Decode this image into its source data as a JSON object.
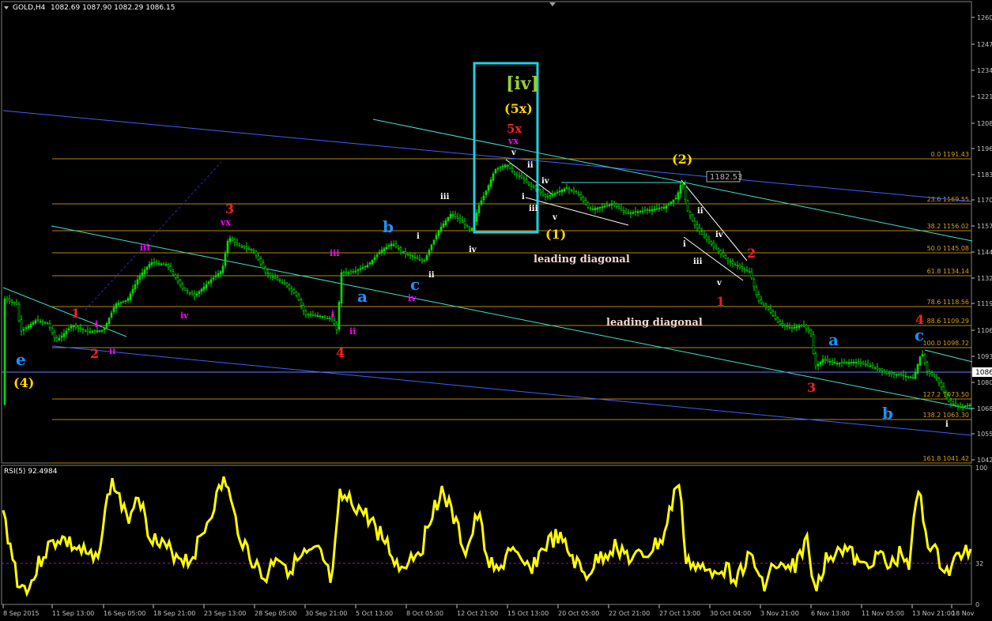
{
  "window": {
    "symbol_label": "GOLD,H4",
    "ohlc": "1082.69 1087.90 1082.29 1086.15",
    "rsi_label": "RSI(5) 92.4984"
  },
  "price_axis": {
    "labels": [
      "1260",
      "1247",
      "1234",
      "1221",
      "1208",
      "1196",
      "1183",
      "1170",
      "1157",
      "1144",
      "1132",
      "1119",
      "1106",
      "1093",
      "1080",
      "1068",
      "1055",
      "1042"
    ],
    "current_price": "1086",
    "range": [
      1037,
      1265
    ]
  },
  "rsi_axis": {
    "labels": [
      "100",
      "32",
      "0"
    ],
    "level": 32
  },
  "time_axis": {
    "labels": [
      "8 Sep 2015",
      "11 Sep 13:00",
      "16 Sep 05:00",
      "18 Sep 21:00",
      "23 Sep 13:00",
      "28 Sep 05:00",
      "30 Sep 21:00",
      "5 Oct 13:00",
      "8 Oct 05:00",
      "12 Oct 21:00",
      "15 Oct 13:00",
      "20 Oct 05:00",
      "22 Oct 21:00",
      "27 Oct 13:00",
      "30 Oct 04:00",
      "3 Nov 21:00",
      "6 Nov 13:00",
      "11 Nov 05:00",
      "13 Nov 21:00",
      "18 Nov"
    ]
  },
  "fib_levels": [
    {
      "label": "0.0  1191.43"
    },
    {
      "label": "23.6  1169.55"
    },
    {
      "label": "38.2  1156.02"
    },
    {
      "label": "50.0  1145.08"
    },
    {
      "label": "61.8  1134.14"
    },
    {
      "label": "78.6  1118.56"
    },
    {
      "label": "88.6  1109.29"
    },
    {
      "label": "100.0  1098.72"
    },
    {
      "label": "127.2  1073.50"
    },
    {
      "label": "138.2  1063.30"
    },
    {
      "label": "161.8  1041.42"
    }
  ],
  "price_tag": "1182.53",
  "annotations": [
    {
      "text": "[iv]"
    },
    {
      "text": "(5x)"
    },
    {
      "text": "5x"
    },
    {
      "text": "vx"
    },
    {
      "text": "v"
    },
    {
      "text": "ii"
    },
    {
      "text": "iv"
    },
    {
      "text": "i"
    },
    {
      "text": "iii"
    },
    {
      "text": "v"
    },
    {
      "text": "(1)"
    },
    {
      "text": "(2)"
    },
    {
      "text": "leading diagonal"
    },
    {
      "text": "leading diagonal"
    },
    {
      "text": "e"
    },
    {
      "text": "(4)"
    },
    {
      "text": "1"
    },
    {
      "text": "2"
    },
    {
      "text": "i"
    },
    {
      "text": "ii"
    },
    {
      "text": "iii"
    },
    {
      "text": "iv"
    },
    {
      "text": "3"
    },
    {
      "text": "vx"
    },
    {
      "text": "iii"
    },
    {
      "text": "i"
    },
    {
      "text": "ii"
    },
    {
      "text": "4"
    },
    {
      "text": "a"
    },
    {
      "text": "b"
    },
    {
      "text": "c"
    },
    {
      "text": "iv"
    },
    {
      "text": "i"
    },
    {
      "text": "ii"
    },
    {
      "text": "iii"
    },
    {
      "text": "iv"
    },
    {
      "text": "ii"
    },
    {
      "text": "iv"
    },
    {
      "text": "i"
    },
    {
      "text": "iii"
    },
    {
      "text": "v"
    },
    {
      "text": "1"
    },
    {
      "text": "2"
    },
    {
      "text": "3"
    },
    {
      "text": "4"
    },
    {
      "text": "a"
    },
    {
      "text": "b"
    },
    {
      "text": "c"
    },
    {
      "text": "i"
    }
  ],
  "colors": {
    "candles": "#00e000",
    "rsi_line": "#ffff00",
    "fib": "#b8860b",
    "trend_blue": "#4060ff",
    "trend_cyan": "#40e0d0",
    "box": "#20d0e0"
  }
}
